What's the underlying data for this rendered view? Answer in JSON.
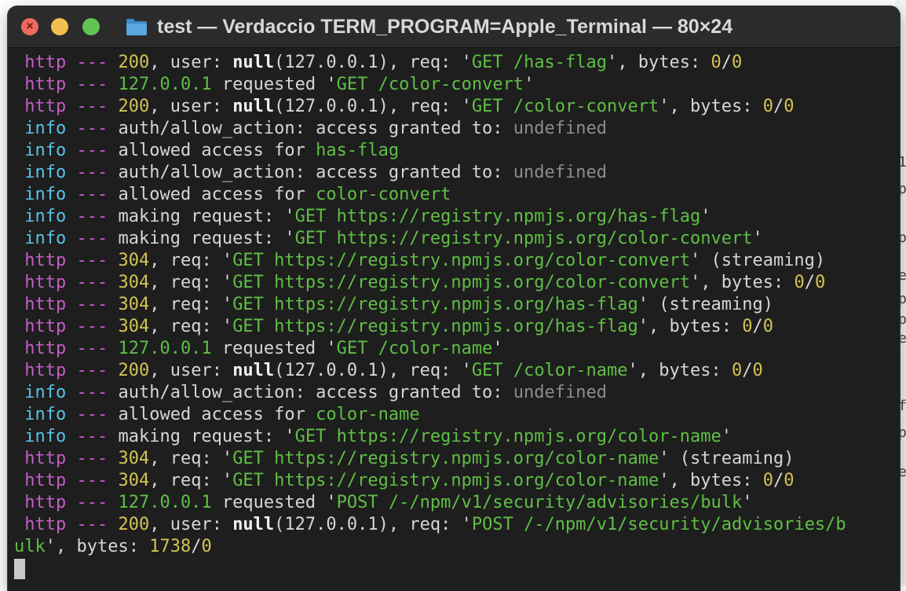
{
  "window": {
    "title": "test — Verdaccio TERM_PROGRAM=Apple_Terminal — 80×24"
  },
  "background_fragments": [
    "1",
    "p",
    "p",
    "e",
    "p",
    "p",
    "e",
    "f",
    "p",
    "e"
  ],
  "terminal": {
    "lines": [
      {
        "level": "http",
        "sep": " --- ",
        "parts": [
          [
            "200",
            "num"
          ],
          [
            ", user: ",
            "plain"
          ],
          [
            "null",
            "bold"
          ],
          [
            "(127.0.0.1), req: '",
            "plain"
          ],
          [
            "GET /has-flag",
            "green"
          ],
          [
            "', bytes: ",
            "plain"
          ],
          [
            "0",
            "num"
          ],
          [
            "/",
            "plain"
          ],
          [
            "0",
            "num"
          ]
        ]
      },
      {
        "level": "http",
        "sep": " --- ",
        "parts": [
          [
            "127.0.0.1",
            "green"
          ],
          [
            " requested '",
            "plain"
          ],
          [
            "GET /color-convert",
            "green"
          ],
          [
            "'",
            "plain"
          ]
        ]
      },
      {
        "level": "http",
        "sep": " --- ",
        "parts": [
          [
            "200",
            "num"
          ],
          [
            ", user: ",
            "plain"
          ],
          [
            "null",
            "bold"
          ],
          [
            "(127.0.0.1), req: '",
            "plain"
          ],
          [
            "GET /color-convert",
            "green"
          ],
          [
            "', bytes: ",
            "plain"
          ],
          [
            "0",
            "num"
          ],
          [
            "/",
            "plain"
          ],
          [
            "0",
            "num"
          ]
        ]
      },
      {
        "level": "info",
        "sep": " --- ",
        "parts": [
          [
            "auth/allow_action: access granted to: ",
            "plain"
          ],
          [
            "undefined",
            "gray"
          ]
        ]
      },
      {
        "level": "info",
        "sep": " --- ",
        "parts": [
          [
            "allowed access for ",
            "plain"
          ],
          [
            "has-flag",
            "green"
          ]
        ]
      },
      {
        "level": "info",
        "sep": " --- ",
        "parts": [
          [
            "auth/allow_action: access granted to: ",
            "plain"
          ],
          [
            "undefined",
            "gray"
          ]
        ]
      },
      {
        "level": "info",
        "sep": " --- ",
        "parts": [
          [
            "allowed access for ",
            "plain"
          ],
          [
            "color-convert",
            "green"
          ]
        ]
      },
      {
        "level": "info",
        "sep": " --- ",
        "parts": [
          [
            "making request: '",
            "plain"
          ],
          [
            "GET https://registry.npmjs.org/has-flag",
            "green"
          ],
          [
            "'",
            "plain"
          ]
        ]
      },
      {
        "level": "info",
        "sep": " --- ",
        "parts": [
          [
            "making request: '",
            "plain"
          ],
          [
            "GET https://registry.npmjs.org/color-convert",
            "green"
          ],
          [
            "'",
            "plain"
          ]
        ]
      },
      {
        "level": "http",
        "sep": " --- ",
        "parts": [
          [
            "304",
            "num"
          ],
          [
            ", req: '",
            "plain"
          ],
          [
            "GET https://registry.npmjs.org/color-convert",
            "green"
          ],
          [
            "' (streaming)",
            "plain"
          ]
        ]
      },
      {
        "level": "http",
        "sep": " --- ",
        "parts": [
          [
            "304",
            "num"
          ],
          [
            ", req: '",
            "plain"
          ],
          [
            "GET https://registry.npmjs.org/color-convert",
            "green"
          ],
          [
            "', bytes: ",
            "plain"
          ],
          [
            "0",
            "num"
          ],
          [
            "/",
            "plain"
          ],
          [
            "0",
            "num"
          ]
        ]
      },
      {
        "level": "http",
        "sep": " --- ",
        "parts": [
          [
            "304",
            "num"
          ],
          [
            ", req: '",
            "plain"
          ],
          [
            "GET https://registry.npmjs.org/has-flag",
            "green"
          ],
          [
            "' (streaming)",
            "plain"
          ]
        ]
      },
      {
        "level": "http",
        "sep": " --- ",
        "parts": [
          [
            "304",
            "num"
          ],
          [
            ", req: '",
            "plain"
          ],
          [
            "GET https://registry.npmjs.org/has-flag",
            "green"
          ],
          [
            "', bytes: ",
            "plain"
          ],
          [
            "0",
            "num"
          ],
          [
            "/",
            "plain"
          ],
          [
            "0",
            "num"
          ]
        ]
      },
      {
        "level": "http",
        "sep": " --- ",
        "parts": [
          [
            "127.0.0.1",
            "green"
          ],
          [
            " requested '",
            "plain"
          ],
          [
            "GET /color-name",
            "green"
          ],
          [
            "'",
            "plain"
          ]
        ]
      },
      {
        "level": "http",
        "sep": " --- ",
        "parts": [
          [
            "200",
            "num"
          ],
          [
            ", user: ",
            "plain"
          ],
          [
            "null",
            "bold"
          ],
          [
            "(127.0.0.1), req: '",
            "plain"
          ],
          [
            "GET /color-name",
            "green"
          ],
          [
            "', bytes: ",
            "plain"
          ],
          [
            "0",
            "num"
          ],
          [
            "/",
            "plain"
          ],
          [
            "0",
            "num"
          ]
        ]
      },
      {
        "level": "info",
        "sep": " --- ",
        "parts": [
          [
            "auth/allow_action: access granted to: ",
            "plain"
          ],
          [
            "undefined",
            "gray"
          ]
        ]
      },
      {
        "level": "info",
        "sep": " --- ",
        "parts": [
          [
            "allowed access for ",
            "plain"
          ],
          [
            "color-name",
            "green"
          ]
        ]
      },
      {
        "level": "info",
        "sep": " --- ",
        "parts": [
          [
            "making request: '",
            "plain"
          ],
          [
            "GET https://registry.npmjs.org/color-name",
            "green"
          ],
          [
            "'",
            "plain"
          ]
        ]
      },
      {
        "level": "http",
        "sep": " --- ",
        "parts": [
          [
            "304",
            "num"
          ],
          [
            ", req: '",
            "plain"
          ],
          [
            "GET https://registry.npmjs.org/color-name",
            "green"
          ],
          [
            "' (streaming)",
            "plain"
          ]
        ]
      },
      {
        "level": "http",
        "sep": " --- ",
        "parts": [
          [
            "304",
            "num"
          ],
          [
            ", req: '",
            "plain"
          ],
          [
            "GET https://registry.npmjs.org/color-name",
            "green"
          ],
          [
            "', bytes: ",
            "plain"
          ],
          [
            "0",
            "num"
          ],
          [
            "/",
            "plain"
          ],
          [
            "0",
            "num"
          ]
        ]
      },
      {
        "level": "http",
        "sep": " --- ",
        "parts": [
          [
            "127.0.0.1",
            "green"
          ],
          [
            " requested '",
            "plain"
          ],
          [
            "POST /-/npm/v1/security/advisories/bulk",
            "green"
          ],
          [
            "'",
            "plain"
          ]
        ]
      },
      {
        "level": "http",
        "sep": " --- ",
        "parts": [
          [
            "200",
            "num"
          ],
          [
            ", user: ",
            "plain"
          ],
          [
            "null",
            "bold"
          ],
          [
            "(127.0.0.1), req: '",
            "plain"
          ],
          [
            "POST /-/npm/v1/security/advisories/b",
            "green"
          ]
        ]
      },
      {
        "level": "",
        "sep": "",
        "parts": [
          [
            "ulk",
            "green"
          ],
          [
            "', bytes: ",
            "plain"
          ],
          [
            "1738",
            "num"
          ],
          [
            "/",
            "plain"
          ],
          [
            "0",
            "num"
          ]
        ]
      }
    ]
  },
  "colors": {
    "http": "#c35ec8",
    "info": "#58c2e6",
    "num": "#d3c353",
    "green": "#5fbf45",
    "gray": "#8c8c8c",
    "background": "#1e1e1e"
  }
}
